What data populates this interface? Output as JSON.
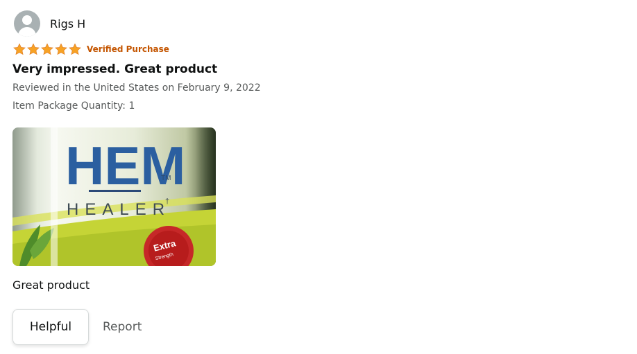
{
  "reviewer": {
    "name": "Rigs H",
    "avatar_icon": "user-avatar-icon"
  },
  "rating": {
    "stars": 5,
    "max": 5,
    "star_color": "#f7a225",
    "verified_label": "Verified Purchase",
    "verified_color": "#c45500"
  },
  "review": {
    "title": "Very impressed. Great product",
    "date": "Reviewed in the United States on February 9, 2022",
    "item_package_quantity": "Item Package Quantity: 1",
    "body": "Great product"
  },
  "review_image": {
    "brand_text": "HEM",
    "trademark": "TM",
    "subtitle": "HEALER",
    "subtitle_mark": "†",
    "badge_line1": "Extra",
    "badge_line2": "Strength"
  },
  "actions": {
    "helpful_label": "Helpful",
    "report_label": "Report"
  }
}
